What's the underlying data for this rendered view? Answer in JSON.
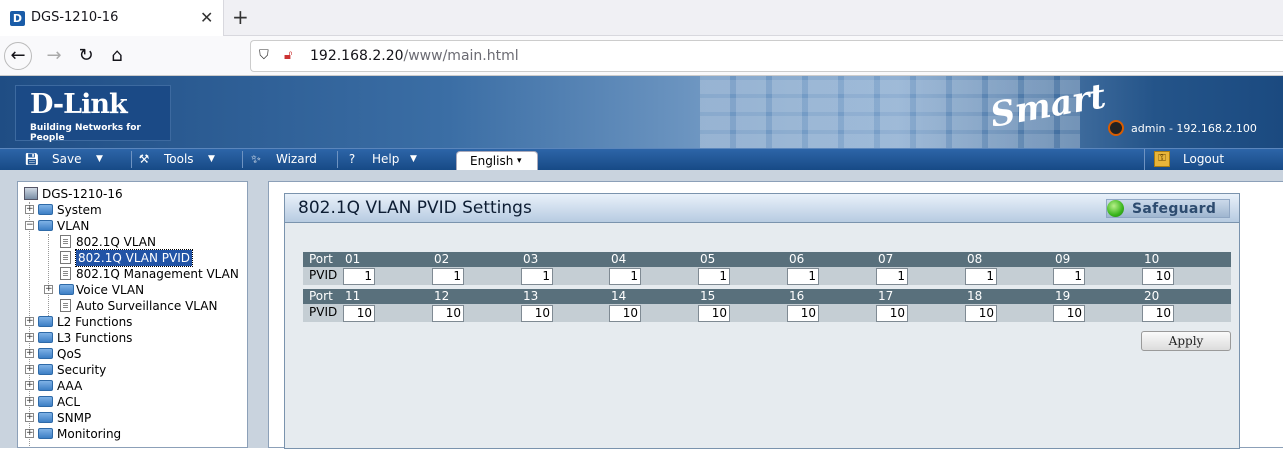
{
  "browser": {
    "tab_title": "DGS-1210-16",
    "tab_icon": "D",
    "url_host": "192.168.2.20",
    "url_path": "/www/main.html"
  },
  "banner": {
    "brand": "D-Link",
    "tagline": "Building Networks for People",
    "product_mark": "Smart",
    "user_info": "admin - 192.168.2.100"
  },
  "menu": {
    "save": "Save",
    "tools": "Tools",
    "wizard": "Wizard",
    "help": "Help",
    "language": "English",
    "logout": "Logout"
  },
  "tree": {
    "root": "DGS-1210-16",
    "items": [
      {
        "label": "System"
      },
      {
        "label": "VLAN"
      },
      {
        "label": "802.1Q VLAN"
      },
      {
        "label": "802.1Q VLAN PVID"
      },
      {
        "label": "802.1Q Management VLAN"
      },
      {
        "label": "Voice VLAN"
      },
      {
        "label": "Auto Surveillance VLAN"
      },
      {
        "label": "L2 Functions"
      },
      {
        "label": "L3 Functions"
      },
      {
        "label": "QoS"
      },
      {
        "label": "Security"
      },
      {
        "label": "AAA"
      },
      {
        "label": "ACL"
      },
      {
        "label": "SNMP"
      },
      {
        "label": "Monitoring"
      }
    ]
  },
  "panel": {
    "title": "802.1Q VLAN PVID Settings",
    "safeguard": "Safeguard",
    "port_label": "Port",
    "pvid_label": "PVID",
    "ports_row1": [
      "01",
      "02",
      "03",
      "04",
      "05",
      "06",
      "07",
      "08",
      "09",
      "10"
    ],
    "pvids_row1": [
      "1",
      "1",
      "1",
      "1",
      "1",
      "1",
      "1",
      "1",
      "1",
      "10"
    ],
    "ports_row2": [
      "11",
      "12",
      "13",
      "14",
      "15",
      "16",
      "17",
      "18",
      "19",
      "20"
    ],
    "pvids_row2": [
      "10",
      "10",
      "10",
      "10",
      "10",
      "10",
      "10",
      "10",
      "10",
      "10"
    ],
    "apply": "Apply"
  }
}
